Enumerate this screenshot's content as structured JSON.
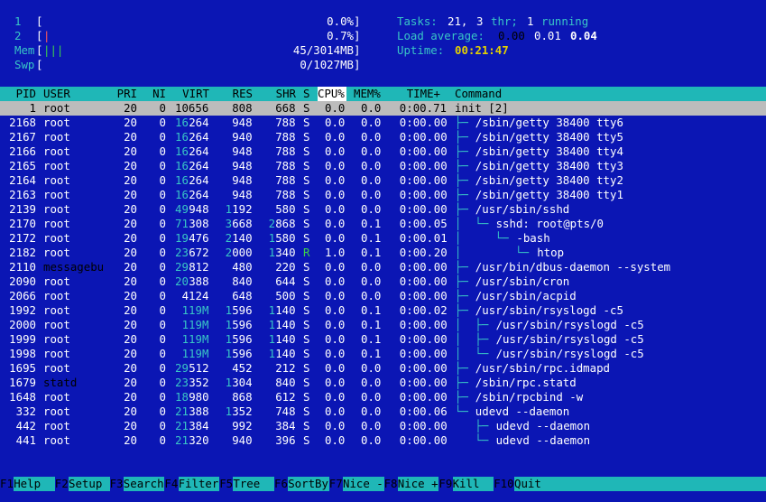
{
  "meters": {
    "cpu1": {
      "label": "1",
      "open": "[",
      "close": "]",
      "value": "0.0%"
    },
    "cpu2": {
      "label": "2",
      "open": "[",
      "bar": "|",
      "close": "]",
      "value": "0.7%"
    },
    "mem": {
      "label": "Mem",
      "open": "[",
      "bar": "|||",
      "close": "]",
      "value": "45/3014MB"
    },
    "swp": {
      "label": "Swp",
      "open": "[",
      "close": "]",
      "value": "0/1027MB"
    }
  },
  "summary": {
    "tasks_label": "Tasks:",
    "tasks_count": "21,",
    "threads_count": "3",
    "threads_label": "thr;",
    "running_count": "1",
    "running_label": "running",
    "load_label": "Load average:",
    "load1": "0.00",
    "load5": "0.01",
    "load15": "0.04",
    "uptime_label": "Uptime:",
    "uptime_value": "00:21:47"
  },
  "columns": {
    "pid": "PID",
    "user": "USER",
    "pri": "PRI",
    "ni": "NI",
    "virt": "VIRT",
    "res": "RES",
    "shr": "SHR",
    "s": "S",
    "cpu": "CPU%",
    "mem": "MEM%",
    "time": "TIME+",
    "command": "Command"
  },
  "processes": [
    {
      "pid": "1",
      "user": "root",
      "pri": "20",
      "ni": "0",
      "virt_hi": "",
      "virt_lo": "10656",
      "res_hi": "",
      "res_lo": "808",
      "shr_hi": "",
      "shr_lo": "668",
      "s": "S",
      "cpu": "0.0",
      "mem": "0.0",
      "time_hi": "0:00.71",
      "time_lo": "",
      "tree": "",
      "cmd": "init [2]",
      "selected": true
    },
    {
      "pid": "2168",
      "user": "root",
      "pri": "20",
      "ni": "0",
      "virt_hi": "16",
      "virt_lo": "264",
      "res_hi": "",
      "res_lo": "948",
      "shr_hi": "",
      "shr_lo": "788",
      "s": "S",
      "cpu": "0.0",
      "mem": "0.0",
      "time_hi": "0:00.",
      "time_lo": "00",
      "tree": "├─ ",
      "cmd": "/sbin/getty 38400 tty6"
    },
    {
      "pid": "2167",
      "user": "root",
      "pri": "20",
      "ni": "0",
      "virt_hi": "16",
      "virt_lo": "264",
      "res_hi": "",
      "res_lo": "940",
      "shr_hi": "",
      "shr_lo": "788",
      "s": "S",
      "cpu": "0.0",
      "mem": "0.0",
      "time_hi": "0:00.",
      "time_lo": "00",
      "tree": "├─ ",
      "cmd": "/sbin/getty 38400 tty5"
    },
    {
      "pid": "2166",
      "user": "root",
      "pri": "20",
      "ni": "0",
      "virt_hi": "16",
      "virt_lo": "264",
      "res_hi": "",
      "res_lo": "948",
      "shr_hi": "",
      "shr_lo": "788",
      "s": "S",
      "cpu": "0.0",
      "mem": "0.0",
      "time_hi": "0:00.",
      "time_lo": "00",
      "tree": "├─ ",
      "cmd": "/sbin/getty 38400 tty4"
    },
    {
      "pid": "2165",
      "user": "root",
      "pri": "20",
      "ni": "0",
      "virt_hi": "16",
      "virt_lo": "264",
      "res_hi": "",
      "res_lo": "948",
      "shr_hi": "",
      "shr_lo": "788",
      "s": "S",
      "cpu": "0.0",
      "mem": "0.0",
      "time_hi": "0:00.",
      "time_lo": "00",
      "tree": "├─ ",
      "cmd": "/sbin/getty 38400 tty3"
    },
    {
      "pid": "2164",
      "user": "root",
      "pri": "20",
      "ni": "0",
      "virt_hi": "16",
      "virt_lo": "264",
      "res_hi": "",
      "res_lo": "948",
      "shr_hi": "",
      "shr_lo": "788",
      "s": "S",
      "cpu": "0.0",
      "mem": "0.0",
      "time_hi": "0:00.",
      "time_lo": "00",
      "tree": "├─ ",
      "cmd": "/sbin/getty 38400 tty2"
    },
    {
      "pid": "2163",
      "user": "root",
      "pri": "20",
      "ni": "0",
      "virt_hi": "16",
      "virt_lo": "264",
      "res_hi": "",
      "res_lo": "948",
      "shr_hi": "",
      "shr_lo": "788",
      "s": "S",
      "cpu": "0.0",
      "mem": "0.0",
      "time_hi": "0:00.",
      "time_lo": "00",
      "tree": "├─ ",
      "cmd": "/sbin/getty 38400 tty1"
    },
    {
      "pid": "2139",
      "user": "root",
      "pri": "20",
      "ni": "0",
      "virt_hi": "49",
      "virt_lo": "948",
      "res_hi": "1",
      "res_lo": "192",
      "shr_hi": "",
      "shr_lo": "580",
      "s": "S",
      "cpu": "0.0",
      "mem": "0.0",
      "time_hi": "0:00.",
      "time_lo": "00",
      "tree": "├─ ",
      "cmd": "/usr/sbin/sshd"
    },
    {
      "pid": "2170",
      "user": "root",
      "pri": "20",
      "ni": "0",
      "virt_hi": "71",
      "virt_lo": "308",
      "res_hi": "3",
      "res_lo": "668",
      "shr_hi": "2",
      "shr_lo": "868",
      "s": "S",
      "cpu": "0.0",
      "mem": "0.1",
      "time_hi": "0:00.",
      "time_lo": "05",
      "tree": "│  └─ ",
      "cmd": "sshd: root@pts/0"
    },
    {
      "pid": "2172",
      "user": "root",
      "pri": "20",
      "ni": "0",
      "virt_hi": "19",
      "virt_lo": "476",
      "res_hi": "2",
      "res_lo": "140",
      "shr_hi": "1",
      "shr_lo": "580",
      "s": "S",
      "cpu": "0.0",
      "mem": "0.1",
      "time_hi": "0:00.",
      "time_lo": "01",
      "tree": "│     └─ ",
      "cmd": "-bash"
    },
    {
      "pid": "2182",
      "user": "root",
      "pri": "20",
      "ni": "0",
      "virt_hi": "23",
      "virt_lo": "672",
      "res_hi": "2",
      "res_lo": "000",
      "shr_hi": "1",
      "shr_lo": "340",
      "s": "R",
      "cpu": "1.0",
      "mem": "0.1",
      "time_hi": "0:00.",
      "time_lo": "20",
      "tree": "│        └─ ",
      "cmd": "htop"
    },
    {
      "pid": "2110",
      "user": "messagebu",
      "pri": "20",
      "ni": "0",
      "virt_hi": "29",
      "virt_lo": "812",
      "res_hi": "",
      "res_lo": "480",
      "shr_hi": "",
      "shr_lo": "220",
      "s": "S",
      "cpu": "0.0",
      "mem": "0.0",
      "time_hi": "0:00.",
      "time_lo": "00",
      "tree": "├─ ",
      "cmd": "/usr/bin/dbus-daemon --system"
    },
    {
      "pid": "2090",
      "user": "root",
      "pri": "20",
      "ni": "0",
      "virt_hi": "20",
      "virt_lo": "388",
      "res_hi": "",
      "res_lo": "840",
      "shr_hi": "",
      "shr_lo": "644",
      "s": "S",
      "cpu": "0.0",
      "mem": "0.0",
      "time_hi": "0:00.",
      "time_lo": "00",
      "tree": "├─ ",
      "cmd": "/usr/sbin/cron"
    },
    {
      "pid": "2066",
      "user": "root",
      "pri": "20",
      "ni": "0",
      "virt_hi": "",
      "virt_lo": "4124",
      "res_hi": "",
      "res_lo": "648",
      "shr_hi": "",
      "shr_lo": "500",
      "s": "S",
      "cpu": "0.0",
      "mem": "0.0",
      "time_hi": "0:00.",
      "time_lo": "00",
      "tree": "├─ ",
      "cmd": "/usr/sbin/acpid"
    },
    {
      "pid": "1992",
      "user": "root",
      "pri": "20",
      "ni": "0",
      "virt_hi": "119M",
      "virt_lo": "",
      "res_hi": "1",
      "res_lo": "596",
      "shr_hi": "1",
      "shr_lo": "140",
      "s": "S",
      "cpu": "0.0",
      "mem": "0.1",
      "time_hi": "0:00.",
      "time_lo": "02",
      "tree": "├─ ",
      "cmd": "/usr/sbin/rsyslogd -c5"
    },
    {
      "pid": "2000",
      "user": "root",
      "pri": "20",
      "ni": "0",
      "virt_hi": "119M",
      "virt_lo": "",
      "res_hi": "1",
      "res_lo": "596",
      "shr_hi": "1",
      "shr_lo": "140",
      "s": "S",
      "cpu": "0.0",
      "mem": "0.1",
      "time_hi": "0:00.",
      "time_lo": "00",
      "tree": "│  ├─ ",
      "cmd": "/usr/sbin/rsyslogd -c5"
    },
    {
      "pid": "1999",
      "user": "root",
      "pri": "20",
      "ni": "0",
      "virt_hi": "119M",
      "virt_lo": "",
      "res_hi": "1",
      "res_lo": "596",
      "shr_hi": "1",
      "shr_lo": "140",
      "s": "S",
      "cpu": "0.0",
      "mem": "0.1",
      "time_hi": "0:00.",
      "time_lo": "00",
      "tree": "│  ├─ ",
      "cmd": "/usr/sbin/rsyslogd -c5"
    },
    {
      "pid": "1998",
      "user": "root",
      "pri": "20",
      "ni": "0",
      "virt_hi": "119M",
      "virt_lo": "",
      "res_hi": "1",
      "res_lo": "596",
      "shr_hi": "1",
      "shr_lo": "140",
      "s": "S",
      "cpu": "0.0",
      "mem": "0.1",
      "time_hi": "0:00.",
      "time_lo": "00",
      "tree": "│  └─ ",
      "cmd": "/usr/sbin/rsyslogd -c5"
    },
    {
      "pid": "1695",
      "user": "root",
      "pri": "20",
      "ni": "0",
      "virt_hi": "29",
      "virt_lo": "512",
      "res_hi": "",
      "res_lo": "452",
      "shr_hi": "",
      "shr_lo": "212",
      "s": "S",
      "cpu": "0.0",
      "mem": "0.0",
      "time_hi": "0:00.",
      "time_lo": "00",
      "tree": "├─ ",
      "cmd": "/usr/sbin/rpc.idmapd"
    },
    {
      "pid": "1679",
      "user": "statd",
      "pri": "20",
      "ni": "0",
      "virt_hi": "23",
      "virt_lo": "352",
      "res_hi": "1",
      "res_lo": "304",
      "shr_hi": "",
      "shr_lo": "840",
      "s": "S",
      "cpu": "0.0",
      "mem": "0.0",
      "time_hi": "0:00.",
      "time_lo": "00",
      "tree": "├─ ",
      "cmd": "/sbin/rpc.statd"
    },
    {
      "pid": "1648",
      "user": "root",
      "pri": "20",
      "ni": "0",
      "virt_hi": "18",
      "virt_lo": "980",
      "res_hi": "",
      "res_lo": "868",
      "shr_hi": "",
      "shr_lo": "612",
      "s": "S",
      "cpu": "0.0",
      "mem": "0.0",
      "time_hi": "0:00.",
      "time_lo": "00",
      "tree": "├─ ",
      "cmd": "/sbin/rpcbind -w"
    },
    {
      "pid": "332",
      "user": "root",
      "pri": "20",
      "ni": "0",
      "virt_hi": "21",
      "virt_lo": "388",
      "res_hi": "1",
      "res_lo": "352",
      "shr_hi": "",
      "shr_lo": "748",
      "s": "S",
      "cpu": "0.0",
      "mem": "0.0",
      "time_hi": "0:00.",
      "time_lo": "06",
      "tree": "└─ ",
      "cmd": "udevd --daemon"
    },
    {
      "pid": "442",
      "user": "root",
      "pri": "20",
      "ni": "0",
      "virt_hi": "21",
      "virt_lo": "384",
      "res_hi": "",
      "res_lo": "992",
      "shr_hi": "",
      "shr_lo": "384",
      "s": "S",
      "cpu": "0.0",
      "mem": "0.0",
      "time_hi": "0:00.",
      "time_lo": "00",
      "tree": "   ├─ ",
      "cmd": "udevd --daemon"
    },
    {
      "pid": "441",
      "user": "root",
      "pri": "20",
      "ni": "0",
      "virt_hi": "21",
      "virt_lo": "320",
      "res_hi": "",
      "res_lo": "940",
      "shr_hi": "",
      "shr_lo": "396",
      "s": "S",
      "cpu": "0.0",
      "mem": "0.0",
      "time_hi": "0:00.",
      "time_lo": "00",
      "tree": "   └─ ",
      "cmd": "udevd --daemon"
    }
  ],
  "function_keys": [
    {
      "key": "F1",
      "label": "Help"
    },
    {
      "key": "F2",
      "label": "Setup"
    },
    {
      "key": "F3",
      "label": "Search"
    },
    {
      "key": "F4",
      "label": "Filter"
    },
    {
      "key": "F5",
      "label": "Tree"
    },
    {
      "key": "F6",
      "label": "SortBy"
    },
    {
      "key": "F7",
      "label": "Nice -"
    },
    {
      "key": "F8",
      "label": "Nice +"
    },
    {
      "key": "F9",
      "label": "Kill"
    },
    {
      "key": "F10",
      "label": "Quit"
    }
  ],
  "colors": {
    "background": "#0b16b4",
    "header_bar": "#1fb7b7",
    "selected_row": "#bcbcbc",
    "accent_cyan": "#39c6c6",
    "meter_green": "#3cd24a",
    "meter_red": "#ff5a5a",
    "uptime_yellow": "#e4d000"
  }
}
